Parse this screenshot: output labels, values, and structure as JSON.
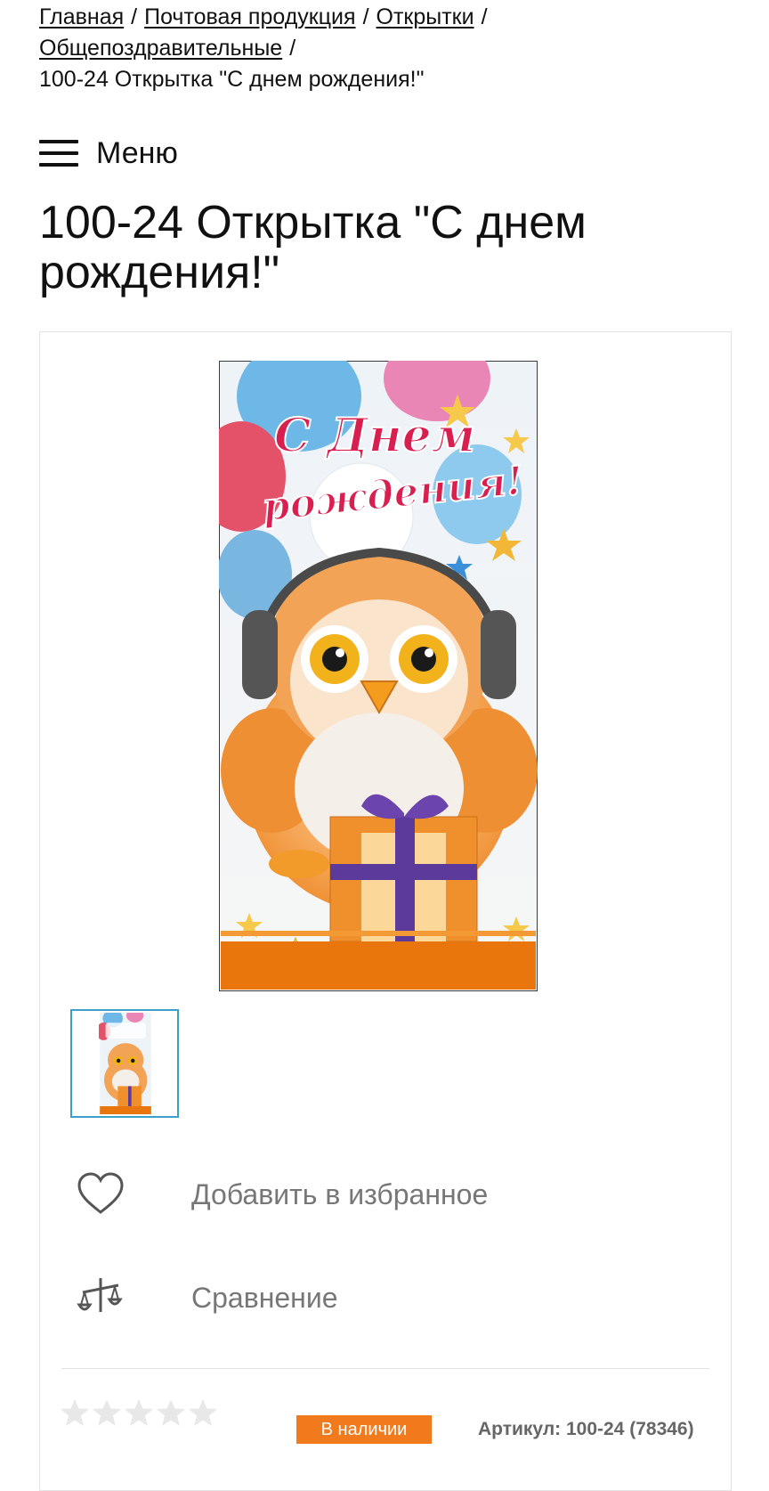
{
  "breadcrumb": {
    "items": [
      "Главная",
      "Почтовая продукция",
      "Открытки",
      "Общепоздравительные"
    ],
    "separator": "/",
    "current": "100-24 Открытка \"С днем рождения!\""
  },
  "menu": {
    "label": "Меню",
    "icon": "hamburger-icon"
  },
  "product": {
    "title": "100-24 Открытка \"С днем рождения!\"",
    "image_text": {
      "line1": "С Днем",
      "line2": "рождения!"
    }
  },
  "actions": {
    "favorite_label": "Добавить в избранное",
    "favorite_icon": "heart-icon",
    "compare_label": "Сравнение",
    "compare_icon": "scales-icon"
  },
  "rating": {
    "value": 0,
    "max": 5
  },
  "availability": {
    "label": "В наличии",
    "color": "#f07a1c"
  },
  "sku": {
    "text": "Артикул: 100-24 (78346)"
  },
  "colors": {
    "accent": "#f07a1c",
    "thumb_border": "#3aa0c8"
  }
}
